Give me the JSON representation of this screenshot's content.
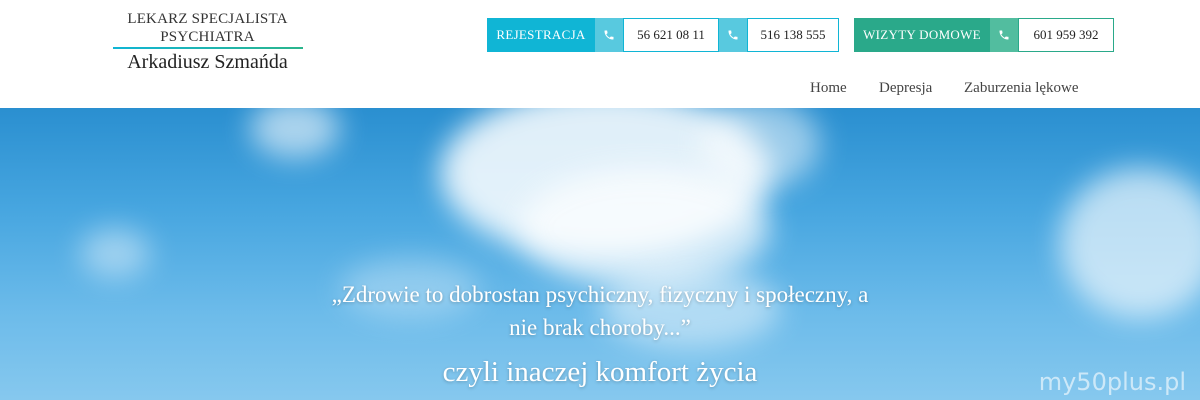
{
  "logo": {
    "title": "LEKARZ SPECJALISTA PSYCHIATRA",
    "name": "Arkadiusz Szmańda"
  },
  "contacts": {
    "registration_label": "REJESTRACJA",
    "phone1": "56 621 08 11",
    "phone2": "516 138 555",
    "home_visits_label": "WIZYTY DOMOWE",
    "phone3": "601 959 392",
    "phone_icon": "phone-icon"
  },
  "nav": {
    "items": [
      "Home",
      "Depresja",
      "Zaburzenia lękowe"
    ]
  },
  "hero": {
    "quote_line1": "„Zdrowie to dobrostan psychiczny, fizyczny i społeczny, a",
    "quote_line2": "nie brak choroby...”",
    "tagline": "czyli inaczej komfort życia"
  },
  "watermark": "my50plus.pl",
  "colors": {
    "registration": "#10b5d5",
    "home_visits": "#2aa98a",
    "sky": "#47a6e0"
  }
}
